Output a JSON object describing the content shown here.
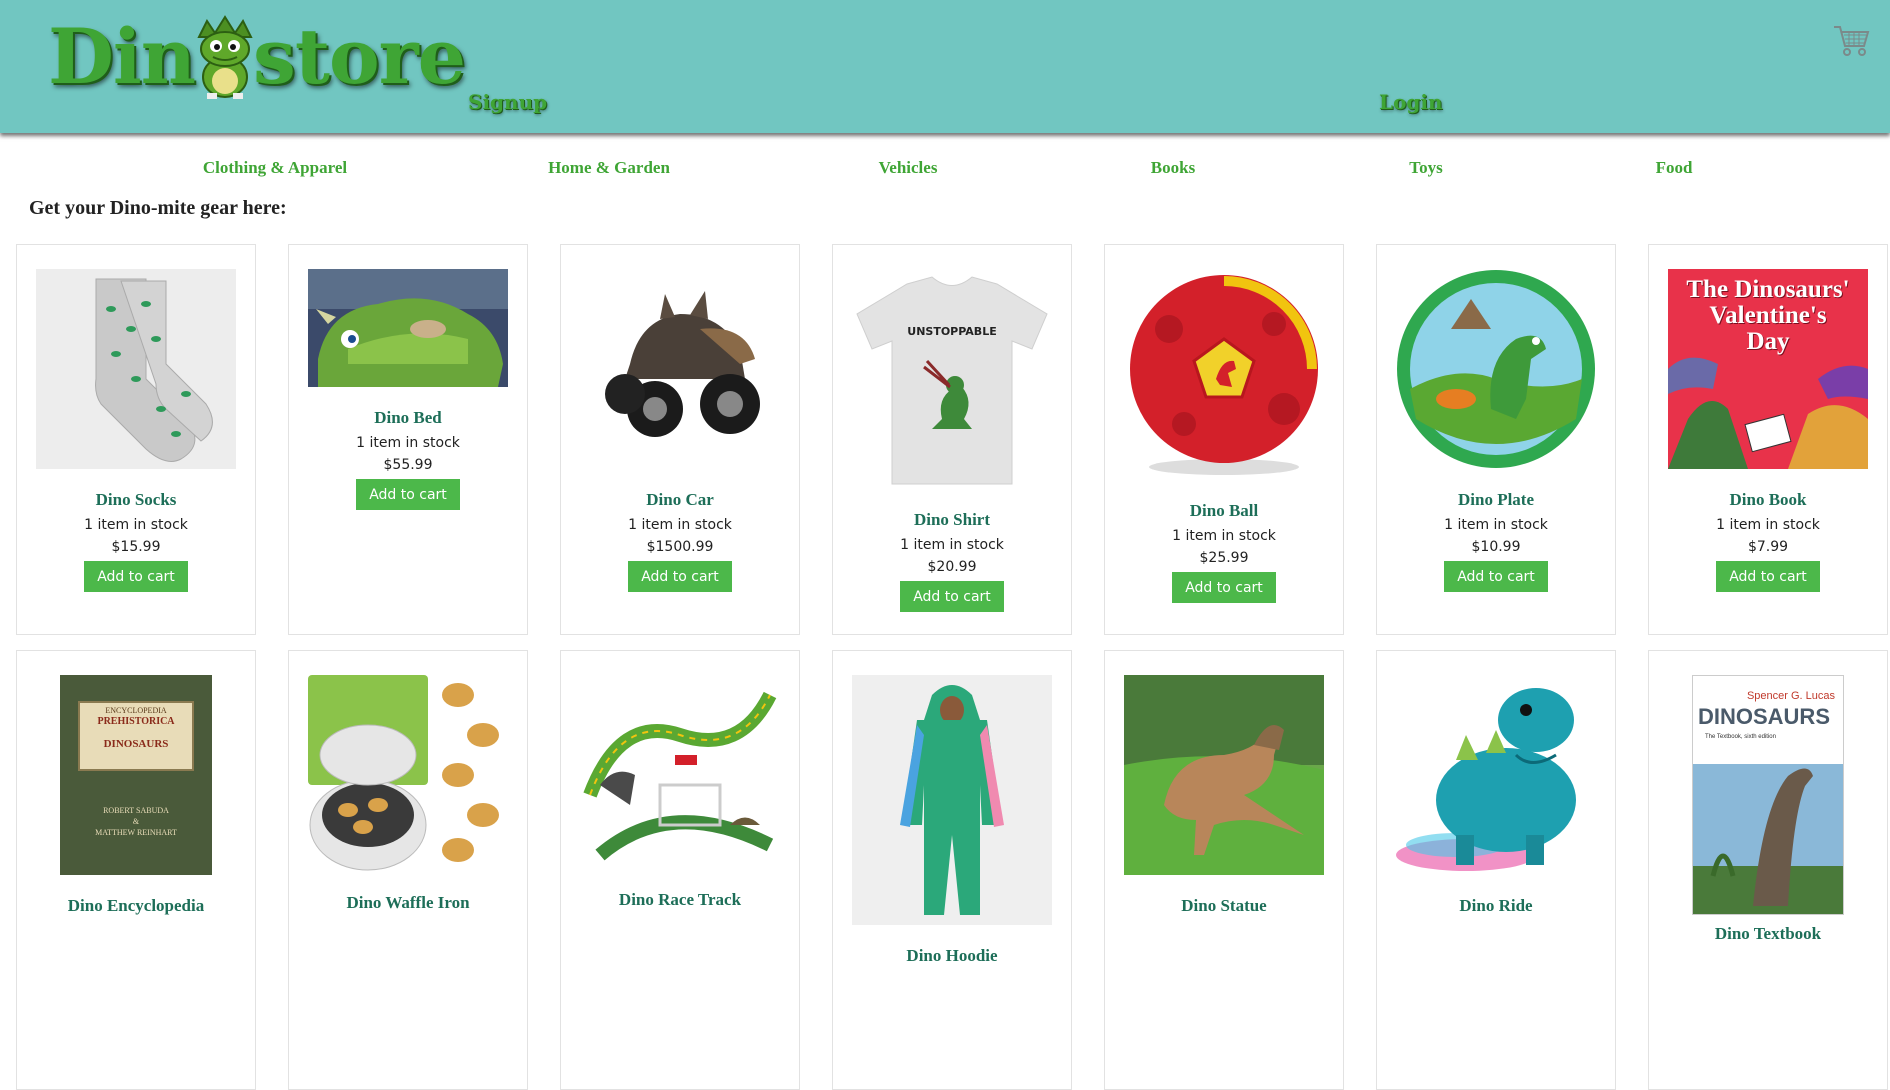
{
  "brand": {
    "pre": "Din",
    "post": "store"
  },
  "nav": {
    "signup": "Signup",
    "login": "Login"
  },
  "categories": [
    "Clothing & Apparel",
    "Home & Garden",
    "Vehicles",
    "Books",
    "Toys",
    "Food"
  ],
  "tagline": "Get your Dino-mite gear here:",
  "products": [
    {
      "name": "Dino Socks",
      "stock": "1 item in stock",
      "price": "$15.99",
      "button": "Add to cart"
    },
    {
      "name": "Dino Bed",
      "stock": "1 item in stock",
      "price": "$55.99",
      "button": "Add to cart"
    },
    {
      "name": "Dino Car",
      "stock": "1 item in stock",
      "price": "$1500.99",
      "button": "Add to cart"
    },
    {
      "name": "Dino Shirt",
      "stock": "1 item in stock",
      "price": "$20.99",
      "button": "Add to cart",
      "shirt_text": "UNSTOPPABLE"
    },
    {
      "name": "Dino Ball",
      "stock": "1 item in stock",
      "price": "$25.99",
      "button": "Add to cart"
    },
    {
      "name": "Dino Plate",
      "stock": "1 item in stock",
      "price": "$10.99",
      "button": "Add to cart"
    },
    {
      "name": "Dino Book",
      "stock": "1 item in stock",
      "price": "$7.99",
      "button": "Add to cart",
      "cover": [
        "The Dinosaurs'",
        "Valentine's",
        "Day"
      ]
    },
    {
      "name": "Dino Encyclopedia",
      "cover": [
        "ENCYCLOPEDIA",
        "PREHISTORICA",
        "DINOSAURS",
        "ROBERT SABUDA",
        "&",
        "MATTHEW REINHART"
      ]
    },
    {
      "name": "Dino Waffle Iron"
    },
    {
      "name": "Dino Race Track"
    },
    {
      "name": "Dino Hoodie"
    },
    {
      "name": "Dino Statue"
    },
    {
      "name": "Dino Ride"
    },
    {
      "name": "Dino Textbook",
      "cover": [
        "Spencer G. Lucas",
        "DINOSAURS",
        "The Textbook, sixth edition"
      ]
    }
  ],
  "colors": {
    "header": "#71c6c1",
    "brand_green": "#3fa535",
    "product_name": "#1d6e58",
    "button": "#4cb84a"
  }
}
